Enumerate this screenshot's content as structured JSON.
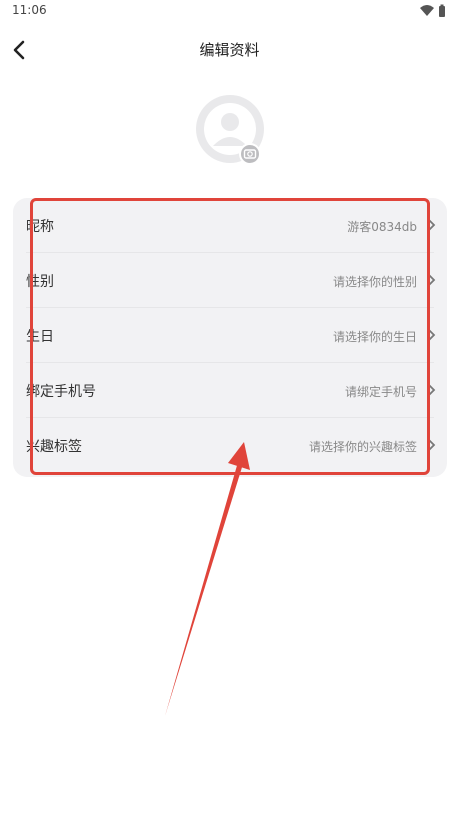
{
  "status_bar": {
    "time": "11:06",
    "icons": [
      "wifi-icon",
      "battery-icon"
    ]
  },
  "nav": {
    "title": "编辑资料",
    "back_icon": "chevron-left-icon"
  },
  "avatar": {
    "icon": "user-avatar-icon",
    "badge_icon": "camera-icon"
  },
  "rows": [
    {
      "label": "昵称",
      "value": "游客0834db"
    },
    {
      "label": "性别",
      "value": "请选择你的性别"
    },
    {
      "label": "生日",
      "value": "请选择你的生日"
    },
    {
      "label": "绑定手机号",
      "value": "请绑定手机号"
    },
    {
      "label": "兴趣标签",
      "value": "请选择你的兴趣标签"
    }
  ],
  "colors": {
    "annotation": "#e0443a",
    "card_bg": "#f2f2f4"
  }
}
